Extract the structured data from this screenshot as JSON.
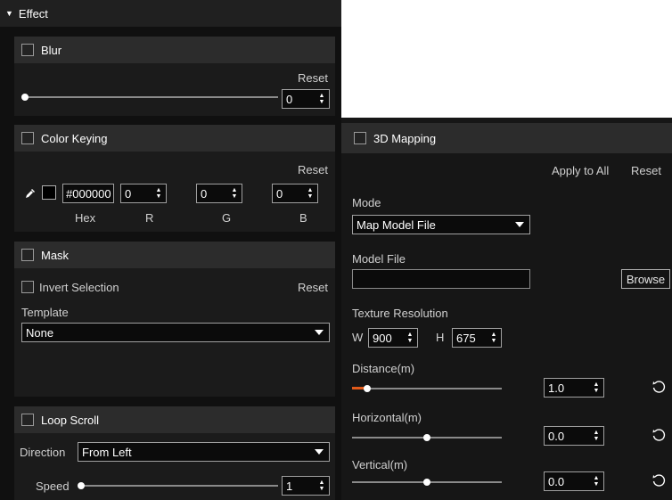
{
  "effect": {
    "title": "Effect"
  },
  "blur": {
    "title": "Blur",
    "reset": "Reset",
    "value": "0",
    "slider": 0.0
  },
  "color_keying": {
    "title": "Color Keying",
    "reset": "Reset",
    "hex": "#000000",
    "r": "0",
    "g": "0",
    "b": "0",
    "labels": {
      "hex": "Hex",
      "r": "R",
      "g": "G",
      "b": "B"
    },
    "swatch_color": "#000000"
  },
  "mask": {
    "title": "Mask",
    "invert_label": "Invert Selection",
    "reset": "Reset",
    "template_label": "Template",
    "template_value": "None"
  },
  "loop_scroll": {
    "title": "Loop Scroll",
    "direction_label": "Direction",
    "direction_value": "From Left",
    "speed_label": "Speed",
    "speed_value": "1",
    "slider": 0.0
  },
  "mapping": {
    "title": "3D Mapping",
    "apply_all": "Apply to All",
    "reset": "Reset",
    "mode_label": "Mode",
    "mode_value": "Map Model File",
    "model_file_label": "Model File",
    "model_file_value": "",
    "browse": "Browse",
    "texture_label": "Texture Resolution",
    "w_label": "W",
    "w_value": "900",
    "h_label": "H",
    "h_value": "675",
    "distance_label": "Distance(m)",
    "distance_value": "1.0",
    "distance_slider": 0.1,
    "horizontal_label": "Horizontal(m)",
    "horizontal_value": "0.0",
    "horizontal_slider": 0.5,
    "vertical_label": "Vertical(m)",
    "vertical_value": "0.0",
    "vertical_slider": 0.5
  },
  "colors": {
    "accent": "#e05a1a",
    "panel": "#1b1b1b",
    "header": "#2c2c2c"
  },
  "icons": {
    "eyedropper": "eyedropper-icon",
    "undo": "reset-arrow-icon",
    "spin": "spin-arrows-icon",
    "caret": "chevron-down-icon"
  }
}
